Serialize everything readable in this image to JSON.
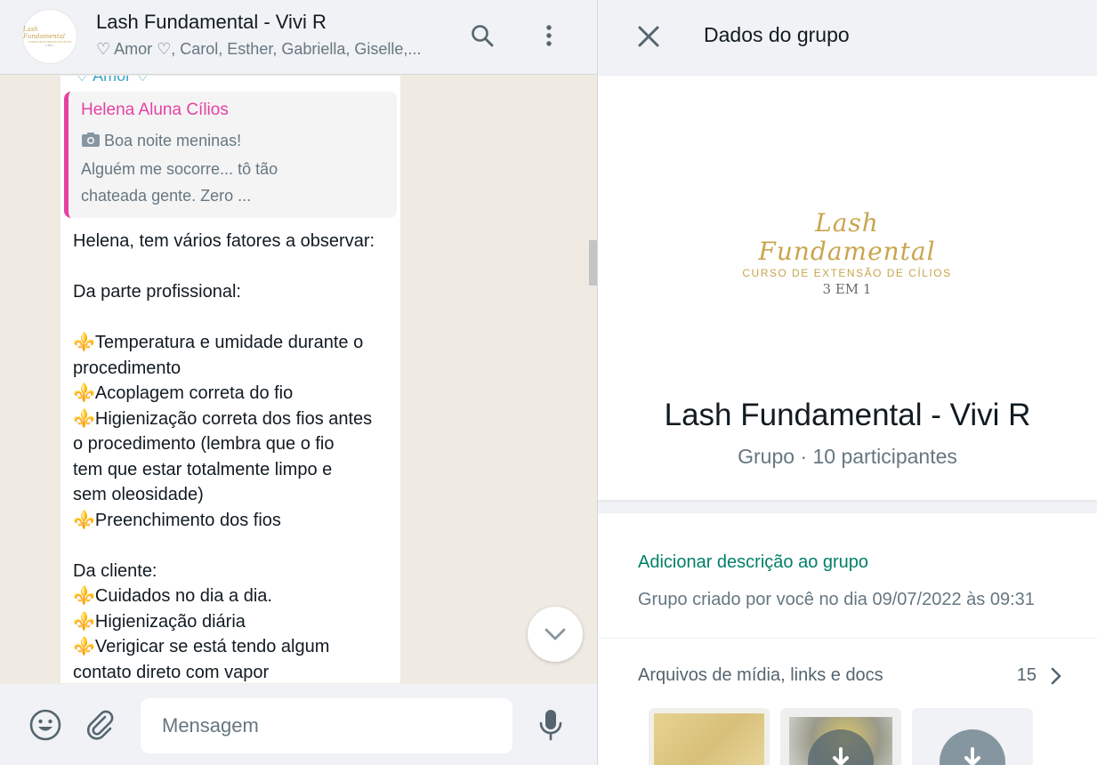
{
  "chat": {
    "avatar_line1": "Lash Fundamental",
    "avatar_line2": "CURSO DE EXTENSÃO DE CÍLIOS",
    "avatar_line3": "3 EM 1",
    "title": "Lash Fundamental - Vivi R",
    "subtitle": "♡ Amor ♡, Carol, Esther, Gabriella, Giselle,...",
    "search_icon": "search-icon",
    "menu_icon": "kebab-menu-icon"
  },
  "message": {
    "sender_partial": "♡ Amor ♡",
    "quote": {
      "author": "Helena Aluna Cílios",
      "camera_icon": "camera-icon",
      "lines": [
        "Boa noite meninas!",
        "Alguém me socorre... tô tão",
        "chateada gente. Zero ..."
      ]
    },
    "lines": [
      "Helena, tem vários fatores a observar:",
      "",
      "Da parte profissional:",
      "",
      "⚜️Temperatura e umidade durante o",
      "procedimento",
      "⚜️Acoplagem correta do fio",
      "⚜️Higienização correta dos fios antes",
      "o procedimento (lembra que o fio",
      "tem que estar totalmente limpo e",
      "sem oleosidade)",
      "⚜️Preenchimento dos fios",
      "",
      "Da cliente:",
      "⚜️Cuidados no dia a dia.",
      "⚜️Higienização diária",
      "⚜️Verigicar se está tendo algum",
      "contato direto com vapor"
    ]
  },
  "composer": {
    "placeholder": "Mensagem",
    "emoji_icon": "emoji-icon",
    "attach_icon": "paperclip-icon",
    "mic_icon": "microphone-icon"
  },
  "info": {
    "header_title": "Dados do grupo",
    "logo_script": "Lash Fundamental",
    "logo_sub": "CURSO DE EXTENSÃO DE CÍLIOS",
    "logo_sub2": "3 EM 1",
    "group_name": "Lash Fundamental - Vivi R",
    "group_meta": "Grupo · 10 participantes",
    "add_description": "Adicionar descrição ao grupo",
    "created": "Grupo criado por você no dia 09/07/2022 às 09:31",
    "media_label": "Arquivos de mídia, links e docs",
    "media_count": "15"
  },
  "colors": {
    "accent_green": "#008069",
    "quote_pink": "#e542a3",
    "panel_bg": "#f0f2f5",
    "chat_bg": "#efeae2",
    "gold": "#c9a54e"
  }
}
